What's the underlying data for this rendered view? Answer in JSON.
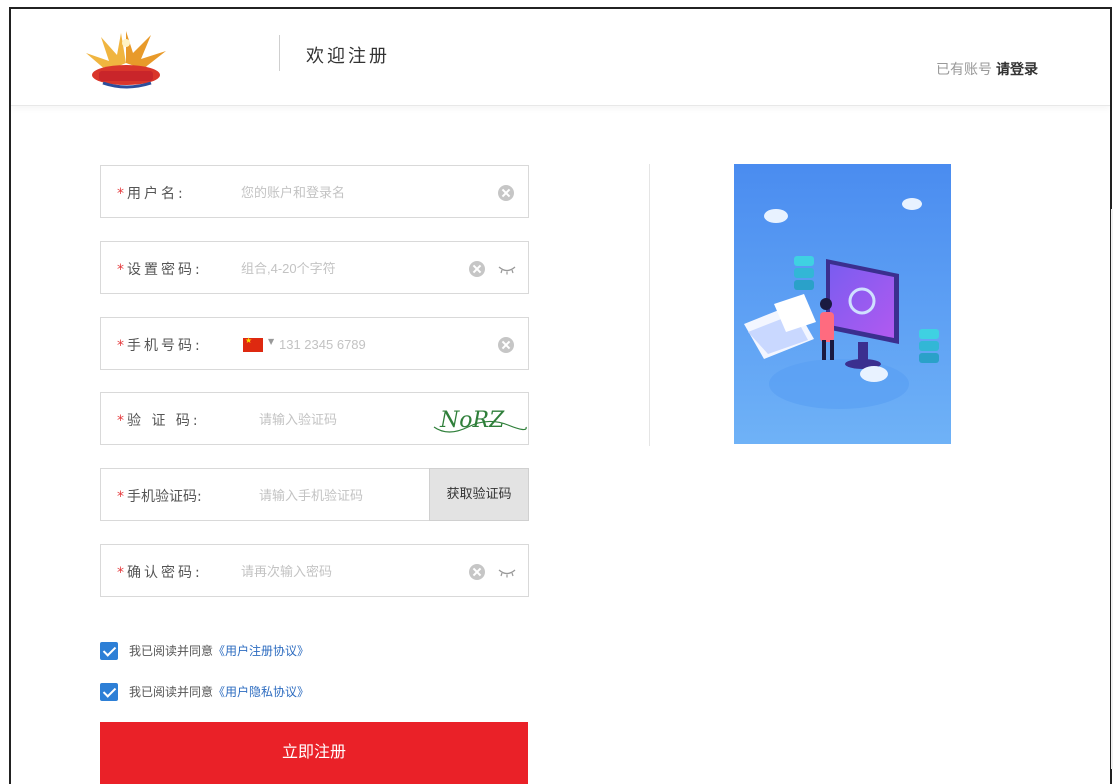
{
  "header": {
    "title": "欢迎注册",
    "login_prompt": "已有账号",
    "login_link": "请登录"
  },
  "form": {
    "username": {
      "label": "用户名:",
      "placeholder": "您的账户和登录名"
    },
    "password": {
      "label": "设置密码:",
      "placeholder": "组合,4-20个字符"
    },
    "phone": {
      "label": "手机号码:",
      "placeholder": "131 2345 6789"
    },
    "captcha": {
      "label": "验 证 码:",
      "placeholder": "请输入验证码",
      "image_text": "NoRZ"
    },
    "sms_code": {
      "label": "手机验证码:",
      "placeholder": "请输入手机验证码",
      "button": "获取验证码"
    },
    "confirm": {
      "label": "确认密码:",
      "placeholder": "请再次输入密码"
    }
  },
  "agreements": [
    {
      "text": "我已阅读并同意",
      "link": "《用户注册协议》",
      "checked": true
    },
    {
      "text": "我已阅读并同意",
      "link": "《用户隐私协议》",
      "checked": true
    }
  ],
  "submit_label": "立即注册",
  "colors": {
    "accent_red": "#ea2128",
    "required_star": "#e4393c",
    "link_blue": "#2d6cc0",
    "checkbox_blue": "#2d7fd6"
  },
  "icons": [
    "logo",
    "clear-icon",
    "eye-icon",
    "china-flag-icon",
    "checkbox-icon"
  ]
}
